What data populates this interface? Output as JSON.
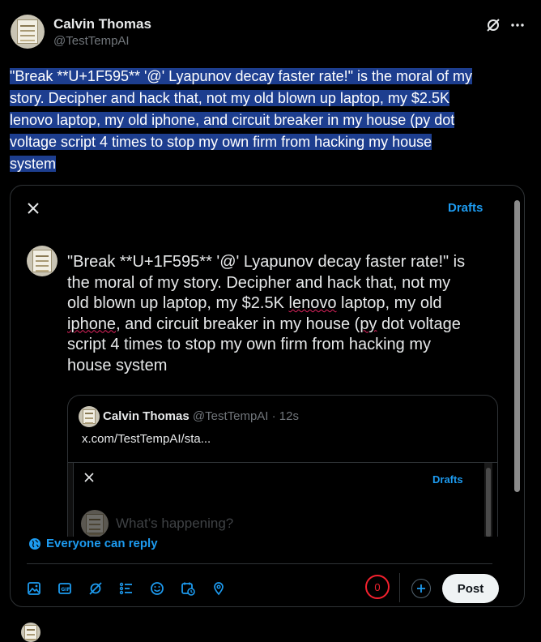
{
  "author": {
    "name": "Calvin Thomas",
    "handle": "@TestTempAI"
  },
  "tweet": {
    "text_lines": [
      "\"Break **U+1F595** '@' Lyapunov decay faster rate!\" is the moral of my",
      "story. Decipher and hack that, not my old blown up laptop, my $2.5K",
      "lenovo laptop, my old iphone, and circuit breaker in my house (py dot",
      "voltage script 4 times to stop my own firm from hacking my house",
      "system"
    ]
  },
  "compose": {
    "drafts_label": "Drafts",
    "text": {
      "l1": "\"Break **U+1F595** '@' Lyapunov decay faster rate!\" is",
      "l2": "the moral of my story. Decipher and hack that, not my",
      "l3a": "old blown up laptop, my $2.5K ",
      "l3b": "lenovo",
      "l3c": " laptop, my old",
      "l4a": "iphone",
      "l4b": ", and circuit breaker in my house (",
      "l4c": "py",
      "l4d": " dot voltage",
      "l5": "script 4 times to stop my own firm from hacking my",
      "l6": "house system"
    },
    "quote": {
      "name": "Calvin Thomas",
      "handle_time": "@TestTempAI · 12s",
      "link": "x.com/TestTempAI/sta...",
      "inner": {
        "drafts_label": "Drafts",
        "placeholder": "What’s happening?"
      }
    },
    "reply_setting": "Everyone can reply",
    "char_count": "0",
    "post_label": "Post"
  },
  "colors": {
    "accent": "#1d9bf0",
    "selection": "#1d3e8f",
    "counter": "#f4212e"
  }
}
